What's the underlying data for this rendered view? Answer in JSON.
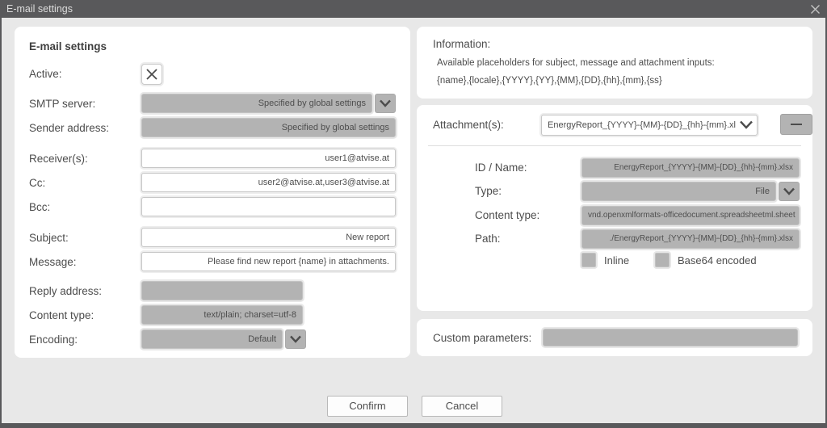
{
  "window": {
    "title": "E-mail settings"
  },
  "email_panel": {
    "heading": "E-mail settings",
    "active_label": "Active:",
    "smtp_label": "SMTP server:",
    "smtp_value": "Specified by global settings",
    "sender_label": "Sender address:",
    "sender_value": "Specified by global settings",
    "receivers_label": "Receiver(s):",
    "receivers_value": "user1@atvise.at",
    "cc_label": "Cc:",
    "cc_value": "user2@atvise.at,user3@atvise.at",
    "bcc_label": "Bcc:",
    "bcc_value": "",
    "subject_label": "Subject:",
    "subject_value": "New report",
    "message_label": "Message:",
    "message_value": "Please find new report {name} in attachments.",
    "reply_label": "Reply address:",
    "reply_value": "",
    "content_type_label": "Content type:",
    "content_type_value": "text/plain; charset=utf-8",
    "encoding_label": "Encoding:",
    "encoding_value": "Default"
  },
  "information": {
    "heading": "Information:",
    "line1": "Available placeholders for subject, message and attachment inputs:",
    "line2": "{name},{locale},{YYYY},{YY},{MM},{DD},{hh},{mm},{ss}"
  },
  "attachments": {
    "label": "Attachment(s):",
    "selected": "EnergyReport_{YYYY}-{MM}-{DD}_{hh}-{mm}.xlsx",
    "id_name_label": "ID / Name:",
    "id_name_value": "EnergyReport_{YYYY}-{MM}-{DD}_{hh}-{mm}.xlsx",
    "type_label": "Type:",
    "type_value": "File",
    "content_type_label": "Content type:",
    "content_type_value": "vnd.openxmlformats-officedocument.spreadsheetml.sheet",
    "path_label": "Path:",
    "path_value": "./EnergyReport_{YYYY}-{MM}-{DD}_{hh}-{mm}.xlsx",
    "inline_label": "Inline",
    "base64_label": "Base64 encoded"
  },
  "custom": {
    "label": "Custom parameters:",
    "value": ""
  },
  "actions": {
    "confirm": "Confirm",
    "cancel": "Cancel"
  },
  "colors": {
    "titlebar": "#59595b",
    "body": "#e8e8e8",
    "field_gray": "#b3b3b3",
    "text": "#4d4d4d"
  }
}
